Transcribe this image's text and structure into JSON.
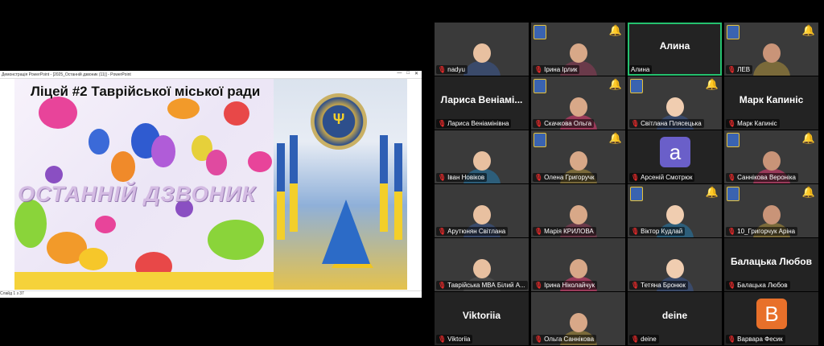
{
  "share": {
    "window_title": "Демонстрація PowerPoint - [2025_Останній дзвоник (11)] - PowerPoint",
    "controls": [
      "—",
      "□",
      "✕"
    ],
    "slide_title": "Ліцей #2 Таврійської міської ради",
    "slide_art_text": "ОСТАННІЙ ДЗВОНИК",
    "emblem": "Ψ",
    "status": "Слайд 1 з 37"
  },
  "colors": {
    "active_border": "#25c16f",
    "mic_off": "#e02a2a"
  },
  "participants": [
    {
      "name": "nadyu",
      "center": "",
      "video": true,
      "muted": true
    },
    {
      "name": "Ірина Ірлик",
      "center": "",
      "video": true,
      "muted": true
    },
    {
      "name": "Алина",
      "center": "Алина",
      "video": false,
      "muted": false,
      "active": true
    },
    {
      "name": "ЛЕВ",
      "center": "",
      "video": true,
      "muted": true
    },
    {
      "name": "Лариса Веніамінівна",
      "center": "Лариса Веніамі...",
      "video": false,
      "muted": true
    },
    {
      "name": "Скачкова Ольга",
      "center": "",
      "video": true,
      "muted": true
    },
    {
      "name": "Світлана Плясецька",
      "center": "",
      "video": true,
      "muted": true
    },
    {
      "name": "Марк Капиніс",
      "center": "Марк Капиніс",
      "video": false,
      "muted": true
    },
    {
      "name": "Іван Новіков",
      "center": "",
      "video": true,
      "muted": true
    },
    {
      "name": "Олена Григоручк",
      "center": "",
      "video": true,
      "muted": true
    },
    {
      "name": "Арсеній Смотрюк",
      "center": "",
      "video": false,
      "muted": true,
      "avatar": "a",
      "avatar_color": "#6a5fc9"
    },
    {
      "name": "Саннікова Вероніка",
      "center": "",
      "video": true,
      "muted": true
    },
    {
      "name": "Арутюнян Світлана",
      "center": "",
      "video": true,
      "muted": true
    },
    {
      "name": "Марія КРИЛОВА",
      "center": "",
      "video": true,
      "muted": true
    },
    {
      "name": "Віктор Кудлай",
      "center": "",
      "video": true,
      "muted": true
    },
    {
      "name": "10_Григорчук Аріна",
      "center": "",
      "video": true,
      "muted": true
    },
    {
      "name": "Таврійська МВА Білий А...",
      "center": "",
      "video": true,
      "muted": true
    },
    {
      "name": "Ірина Ніколайчук",
      "center": "",
      "video": true,
      "muted": true
    },
    {
      "name": "Тетяна Бронюк",
      "center": "",
      "video": true,
      "muted": true
    },
    {
      "name": "Балацька Любов",
      "center": "Балацька Любов",
      "video": false,
      "muted": true
    },
    {
      "name": "Viktoriia",
      "center": "Viktoriia",
      "video": false,
      "muted": true
    },
    {
      "name": "Ольга Саннікова",
      "center": "",
      "video": true,
      "muted": true
    },
    {
      "name": "deine",
      "center": "deine",
      "video": false,
      "muted": true
    },
    {
      "name": "Варвара Фесик",
      "center": "",
      "video": false,
      "muted": true,
      "avatar": "B",
      "avatar_color": "#e8702a"
    }
  ]
}
